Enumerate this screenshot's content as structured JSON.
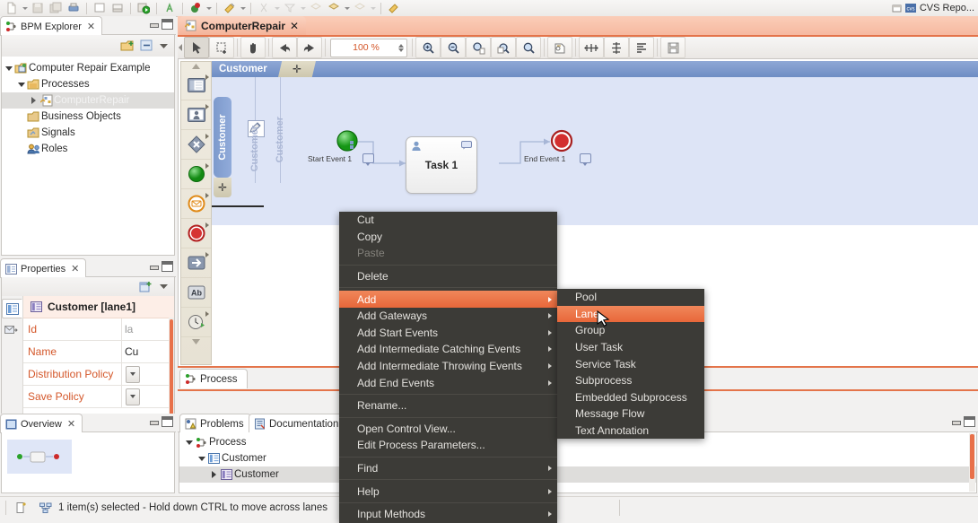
{
  "window": {
    "cvs_label": "CVS Repo..."
  },
  "bpm_explorer": {
    "tab_label": "BPM Explorer",
    "tab_close": "✕",
    "tree": [
      {
        "label": "Computer Repair Example",
        "icon": "project-icon",
        "depth": 0,
        "twist": "down",
        "selected": false
      },
      {
        "label": "Processes",
        "icon": "folder-processes-icon",
        "depth": 1,
        "twist": "down",
        "selected": false
      },
      {
        "label": "ComputerRepair",
        "icon": "process-icon",
        "depth": 2,
        "twist": "right",
        "selected": true
      },
      {
        "label": "Business Objects",
        "icon": "folder-objects-icon",
        "depth": 1,
        "twist": "none",
        "selected": false
      },
      {
        "label": "Signals",
        "icon": "folder-signals-icon",
        "depth": 1,
        "twist": "none",
        "selected": false
      },
      {
        "label": "Roles",
        "icon": "roles-icon",
        "depth": 1,
        "twist": "none",
        "selected": false
      }
    ]
  },
  "properties": {
    "tab_label": "Properties",
    "tab_close": "✕",
    "title": "Customer [lane1]",
    "rows": [
      {
        "label": "Id",
        "value": "la",
        "kind": "text-grey"
      },
      {
        "label": "Name",
        "value": "Cu",
        "kind": "text"
      },
      {
        "label": "Distribution Policy",
        "value": "",
        "kind": "combo"
      },
      {
        "label": "Save Policy",
        "value": "",
        "kind": "combo"
      }
    ]
  },
  "overview": {
    "tab_label": "Overview",
    "tab_close": "✕"
  },
  "editor": {
    "tab_label": "ComputerRepair",
    "tab_close": "✕",
    "zoom": "100 %",
    "toolbar_icons": [
      "select-arrow-icon",
      "marquee-select-icon",
      "pan-hand-icon",
      "undo-arrow-icon",
      "redo-arrow-icon",
      "zoom-in-icon",
      "zoom-out-icon",
      "zoom-page-icon",
      "zoom-width-icon",
      "zoom-actual-icon",
      "fit-page-icon",
      "distribute-horizontal-icon",
      "distribute-vertical-icon",
      "align-icon",
      "save-image-icon"
    ],
    "palette": [
      "pool-icon",
      "lane-icon",
      "gateway-icon",
      "start-event-icon",
      "intermediate-event-icon",
      "end-event-icon",
      "task-icon",
      "text-annotation-icon",
      "timer-event-icon"
    ],
    "canvas": {
      "pool_name": "Customer",
      "pool_plus": "✛",
      "lane_name": "Customer",
      "lane_plus": "✛",
      "vertical_labels": [
        "Customer",
        "Customer"
      ],
      "nodes": [
        {
          "type": "start-event",
          "label": "Start Event 1"
        },
        {
          "type": "user-task",
          "label": "Task 1"
        },
        {
          "type": "end-event",
          "label": "End Event 1"
        }
      ]
    },
    "bottom_tab": "Process"
  },
  "bottom_view": {
    "tabs": [
      {
        "label": "Problems",
        "icon": "problems-icon",
        "selected": true
      },
      {
        "label": "Documentation",
        "icon": "documentation-icon",
        "selected": false
      }
    ],
    "tree": [
      {
        "label": "Process",
        "icon": "process-node-icon",
        "depth": 0,
        "twist": "down",
        "selected": false
      },
      {
        "label": "Customer",
        "icon": "pool-node-icon",
        "depth": 1,
        "twist": "down",
        "selected": false
      },
      {
        "label": "Customer",
        "icon": "lane-node-icon",
        "depth": 2,
        "twist": "right",
        "selected": true
      }
    ]
  },
  "status_bar": {
    "message": "1 item(s) selected - Hold down CTRL to move across lanes"
  },
  "context_menu": {
    "items": [
      {
        "label": "Cut",
        "sub": false,
        "disabled": false,
        "highlight": false
      },
      {
        "label": "Copy",
        "sub": false,
        "disabled": false,
        "highlight": false
      },
      {
        "label": "Paste",
        "sub": false,
        "disabled": true,
        "highlight": false
      },
      {
        "sep": true
      },
      {
        "label": "Delete",
        "sub": false,
        "disabled": false,
        "highlight": false
      },
      {
        "sep": true
      },
      {
        "label": "Add",
        "sub": true,
        "disabled": false,
        "highlight": true
      },
      {
        "label": "Add Gateways",
        "sub": true,
        "disabled": false,
        "highlight": false
      },
      {
        "label": "Add Start Events",
        "sub": true,
        "disabled": false,
        "highlight": false
      },
      {
        "label": "Add Intermediate Catching Events",
        "sub": true,
        "disabled": false,
        "highlight": false
      },
      {
        "label": "Add Intermediate Throwing Events",
        "sub": true,
        "disabled": false,
        "highlight": false
      },
      {
        "label": "Add End Events",
        "sub": true,
        "disabled": false,
        "highlight": false
      },
      {
        "sep": true
      },
      {
        "label": "Rename...",
        "sub": false,
        "disabled": false,
        "highlight": false
      },
      {
        "sep": true
      },
      {
        "label": "Open Control View...",
        "sub": false,
        "disabled": false,
        "highlight": false
      },
      {
        "label": "Edit Process Parameters...",
        "sub": false,
        "disabled": false,
        "highlight": false
      },
      {
        "sep": true
      },
      {
        "label": "Find",
        "sub": true,
        "disabled": false,
        "highlight": false
      },
      {
        "sep": true
      },
      {
        "label": "Help",
        "sub": true,
        "disabled": false,
        "highlight": false
      },
      {
        "sep": true
      },
      {
        "label": "Input Methods",
        "sub": true,
        "disabled": false,
        "highlight": false
      }
    ]
  },
  "context_submenu": {
    "items": [
      {
        "label": "Pool",
        "highlight": false
      },
      {
        "label": "Lane",
        "highlight": true
      },
      {
        "label": "Group",
        "highlight": false
      },
      {
        "label": "User Task",
        "highlight": false
      },
      {
        "label": "Service Task",
        "highlight": false
      },
      {
        "label": "Subprocess",
        "highlight": false
      },
      {
        "label": "Embedded Subprocess",
        "highlight": false
      },
      {
        "label": "Message Flow",
        "highlight": false
      },
      {
        "label": "Text Annotation",
        "highlight": false
      }
    ]
  },
  "colors": {
    "accent_orange": "#e8673a",
    "menu_bg": "#3c3b37",
    "pool_blue": "#dde4f6",
    "lane_blue": "#7d9acc",
    "prop_label": "#d4572a"
  }
}
